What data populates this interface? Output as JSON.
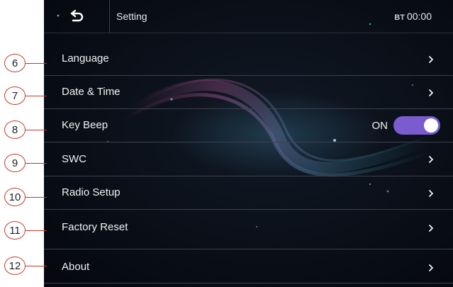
{
  "header": {
    "title": "Setting",
    "bt_label": "BT",
    "time": "00:00",
    "back_icon": "back-arrow-icon"
  },
  "menu": [
    {
      "label": "Language",
      "control": "chevron",
      "callout": "6"
    },
    {
      "label": "Date & Time",
      "control": "chevron",
      "callout": "7"
    },
    {
      "label": "Key Beep",
      "control": "toggle",
      "state": "ON",
      "callout": "8"
    },
    {
      "label": "SWC",
      "control": "chevron",
      "callout": "9"
    },
    {
      "label": "Radio Setup",
      "control": "chevron",
      "callout": "10"
    },
    {
      "label": "Factory Reset",
      "control": "chevron",
      "callout": "11"
    },
    {
      "label": "About",
      "control": "chevron",
      "callout": "12"
    }
  ],
  "colors": {
    "toggle_on": "#7a5cd0",
    "callout_border": "#c0392b",
    "background": "#0a0f18"
  }
}
